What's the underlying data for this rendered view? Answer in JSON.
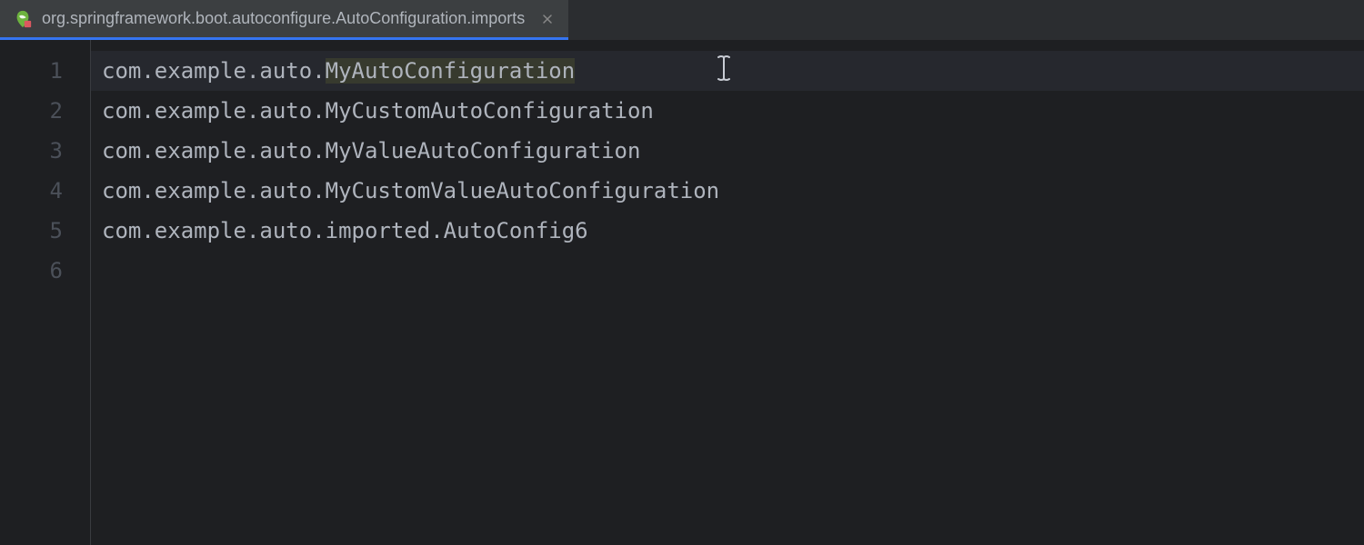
{
  "tab": {
    "title": "org.springframework.boot.autoconfigure.AutoConfiguration.imports",
    "icon": "spring-file-icon"
  },
  "editor": {
    "lines": [
      {
        "number": "1",
        "prefix": "com.example.auto.",
        "highlighted": "MyAutoConfiguration",
        "suffix": ""
      },
      {
        "number": "2",
        "prefix": "com.example.auto.MyCustomAutoConfiguration",
        "highlighted": "",
        "suffix": ""
      },
      {
        "number": "3",
        "prefix": "com.example.auto.MyValueAutoConfiguration",
        "highlighted": "",
        "suffix": ""
      },
      {
        "number": "4",
        "prefix": "com.example.auto.MyCustomValueAutoConfiguration",
        "highlighted": "",
        "suffix": ""
      },
      {
        "number": "5",
        "prefix": "com.example.auto.imported.AutoConfig6",
        "highlighted": "",
        "suffix": ""
      },
      {
        "number": "6",
        "prefix": "",
        "highlighted": "",
        "suffix": ""
      }
    ],
    "currentLine": 0
  }
}
